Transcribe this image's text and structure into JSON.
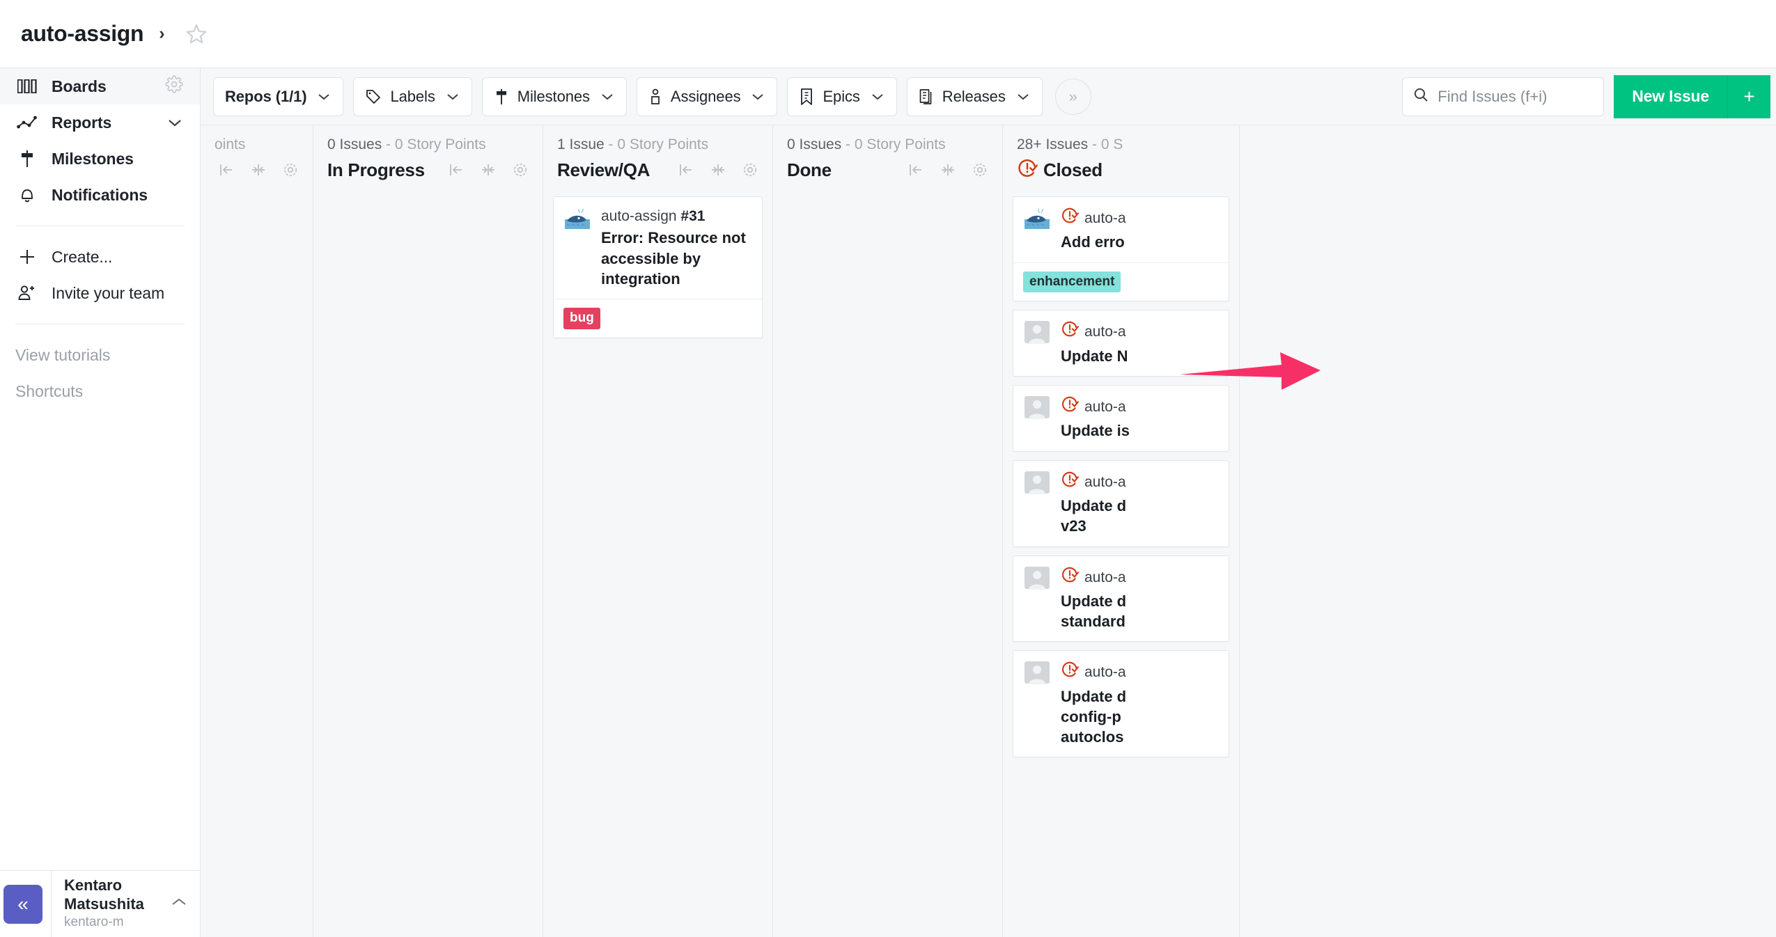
{
  "header": {
    "repo_title": "auto-assign",
    "breadcrumb_chevron": "chevron-right",
    "star_icon": "star-outline-icon"
  },
  "sidebar": {
    "items": [
      {
        "label": "Boards",
        "icon": "boards-icon",
        "active": true,
        "trailing": "gear-icon"
      },
      {
        "label": "Reports",
        "icon": "reports-icon",
        "active": false,
        "trailing": "chevron-down-icon"
      },
      {
        "label": "Milestones",
        "icon": "milestone-signpost-icon",
        "active": false,
        "trailing": ""
      },
      {
        "label": "Notifications",
        "icon": "bell-icon",
        "active": false,
        "trailing": ""
      }
    ],
    "secondary": [
      {
        "label": "Create...",
        "icon": "plus-icon"
      },
      {
        "label": "Invite your team",
        "icon": "person-plus-icon"
      }
    ],
    "tertiary": [
      {
        "label": "View tutorials"
      },
      {
        "label": "Shortcuts"
      }
    ],
    "footer": {
      "collapse_icon": "double-chevron-left-icon",
      "user_name": "Kentaro Matsushita",
      "user_handle": "kentaro-m",
      "caret_icon": "chevron-up-icon"
    }
  },
  "toolbar": {
    "filters": [
      {
        "label": "Repos (1/1)",
        "icon": "",
        "bold": true,
        "caret": true
      },
      {
        "label": "Labels",
        "icon": "tag-icon",
        "bold": false,
        "caret": true
      },
      {
        "label": "Milestones",
        "icon": "milestone-signpost-icon",
        "bold": false,
        "caret": true
      },
      {
        "label": "Assignees",
        "icon": "person-icon",
        "bold": false,
        "caret": true
      },
      {
        "label": "Epics",
        "icon": "epic-bookmark-icon",
        "bold": false,
        "caret": true
      },
      {
        "label": "Releases",
        "icon": "releases-stack-icon",
        "bold": false,
        "caret": true
      }
    ],
    "overflow_label": "»",
    "search": {
      "placeholder": "Find Issues (f+i)",
      "value": "",
      "icon": "search-icon"
    },
    "new_issue_label": "New Issue",
    "new_issue_plus": "+",
    "accent_green": "#00c281"
  },
  "board": {
    "columns": [
      {
        "id": "col-partial-left",
        "counts_issues": "",
        "counts_points": "oints",
        "title": "",
        "clipped": true,
        "cards": []
      },
      {
        "id": "col-in-progress",
        "counts_issues": "0 Issues",
        "counts_sep": " - ",
        "counts_points": "0 Story Points",
        "title": "In Progress",
        "cards": []
      },
      {
        "id": "col-review-qa",
        "counts_issues": "1 Issue",
        "counts_sep": " - ",
        "counts_points": "0 Story Points",
        "title": "Review/QA",
        "cards": [
          {
            "avatar": "whale-avatar",
            "repo": "auto-assign",
            "number": "#31",
            "title": "Error: Resource not accessible by integration",
            "state_icon": "",
            "labels": [
              {
                "text": "bug",
                "kind": "bug"
              }
            ]
          }
        ]
      },
      {
        "id": "col-done",
        "counts_issues": "0 Issues",
        "counts_sep": " - ",
        "counts_points": "0 Story Points",
        "title": "Done",
        "cards": []
      },
      {
        "id": "col-closed",
        "counts_issues": "28+ Issues",
        "counts_sep": " - ",
        "counts_points": "0 S",
        "title": "Closed",
        "title_icon": "issue-closed-icon",
        "clipped_right": true,
        "cards": [
          {
            "avatar": "whale-avatar",
            "repo": "auto-a",
            "number": "",
            "title": "Add erro",
            "state_icon": "issue-closed-icon",
            "labels": [
              {
                "text": "enhancement",
                "kind": "enhancement"
              }
            ]
          },
          {
            "avatar": "generic-avatar",
            "repo": "auto-a",
            "number": "",
            "title": "Update N",
            "state_icon": "issue-closed-icon",
            "labels": []
          },
          {
            "avatar": "generic-avatar",
            "repo": "auto-a",
            "number": "",
            "title": "Update is",
            "state_icon": "issue-closed-icon",
            "labels": []
          },
          {
            "avatar": "generic-avatar",
            "repo": "auto-a",
            "number": "",
            "title": "Update d\nv23",
            "state_icon": "issue-closed-icon",
            "labels": []
          },
          {
            "avatar": "generic-avatar",
            "repo": "auto-a",
            "number": "",
            "title": "Update d\nstandard",
            "state_icon": "issue-closed-icon",
            "labels": []
          },
          {
            "avatar": "generic-avatar",
            "repo": "auto-a",
            "number": "",
            "title": "Update d\nconfig-p\nautoclos",
            "state_icon": "issue-closed-icon",
            "labels": []
          }
        ]
      }
    ],
    "column_action_icons": [
      "move-left-icon",
      "collapse-column-icon",
      "gear-icon"
    ]
  },
  "annotation": {
    "arrow_color": "#f72f67",
    "arrow_name": "pink-pointer-arrow"
  }
}
